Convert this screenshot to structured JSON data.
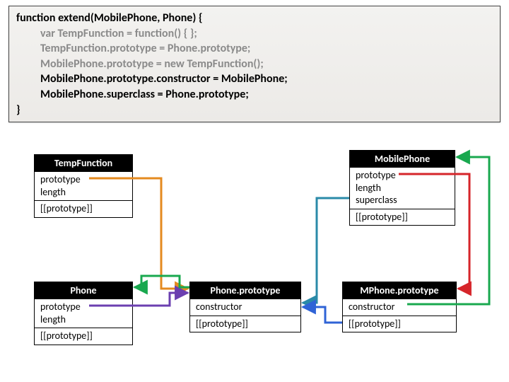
{
  "code": {
    "l1a": "function extend(MobilePhone, Phone) {",
    "l2": "var TempFunction = function() { };",
    "l3": "TempFunction.prototype = Phone.prototype;",
    "l4": "MobilePhone.prototype = new TempFunction();",
    "l5": "MobilePhone.prototype.constructor = MobilePhone;",
    "l6": "MobilePhone.superclass = Phone.prototype;",
    "l7": "}"
  },
  "boxes": {
    "temp": {
      "title": "TempFunction",
      "p1": "prototype",
      "p2": "length",
      "hidden": "[[prototype]]"
    },
    "phone": {
      "title": "Phone",
      "p1": "prototype",
      "p2": "length",
      "hidden": "[[prototype]]"
    },
    "phoneProto": {
      "title": "Phone.prototype",
      "p1": "constructor",
      "hidden": "[[prototype]]"
    },
    "mobile": {
      "title": "MobilePhone",
      "p1": "prototype",
      "p2": "length",
      "p3": "superclass",
      "hidden": "[[prototype]]"
    },
    "mproto": {
      "title": "MPhone.prototype",
      "p1": "constructor",
      "hidden": "[[prototype]]"
    }
  },
  "colors": {
    "orange": "#e48a1f",
    "purple": "#6b3fb0",
    "green": "#19a84f",
    "teal": "#2a8aa8",
    "blue": "#2f63d6",
    "red": "#d6252a"
  },
  "chart_data": {
    "type": "diagram",
    "title": "JavaScript prototype inheritance via extend()",
    "nodes": [
      {
        "id": "TempFunction",
        "props": [
          "prototype",
          "length"
        ],
        "internal": [
          "[[prototype]]"
        ]
      },
      {
        "id": "Phone",
        "props": [
          "prototype",
          "length"
        ],
        "internal": [
          "[[prototype]]"
        ]
      },
      {
        "id": "Phone.prototype",
        "props": [
          "constructor"
        ],
        "internal": [
          "[[prototype]]"
        ]
      },
      {
        "id": "MobilePhone",
        "props": [
          "prototype",
          "length",
          "superclass"
        ],
        "internal": [
          "[[prototype]]"
        ]
      },
      {
        "id": "MPhone.prototype",
        "props": [
          "constructor"
        ],
        "internal": [
          "[[prototype]]"
        ]
      }
    ],
    "edges": [
      {
        "from": "TempFunction.prototype",
        "to": "Phone.prototype",
        "color": "orange"
      },
      {
        "from": "Phone.prototype",
        "to": "Phone.prototype",
        "color": "purple"
      },
      {
        "from": "Phone.prototype.constructor",
        "to": "Phone",
        "color": "green"
      },
      {
        "from": "MobilePhone.superclass",
        "to": "Phone.prototype",
        "color": "teal"
      },
      {
        "from": "MPhone.prototype.[[prototype]]",
        "to": "Phone.prototype",
        "color": "blue"
      },
      {
        "from": "MobilePhone.prototype",
        "to": "MPhone.prototype",
        "color": "red"
      },
      {
        "from": "MPhone.prototype.constructor",
        "to": "MobilePhone",
        "color": "green"
      }
    ]
  }
}
